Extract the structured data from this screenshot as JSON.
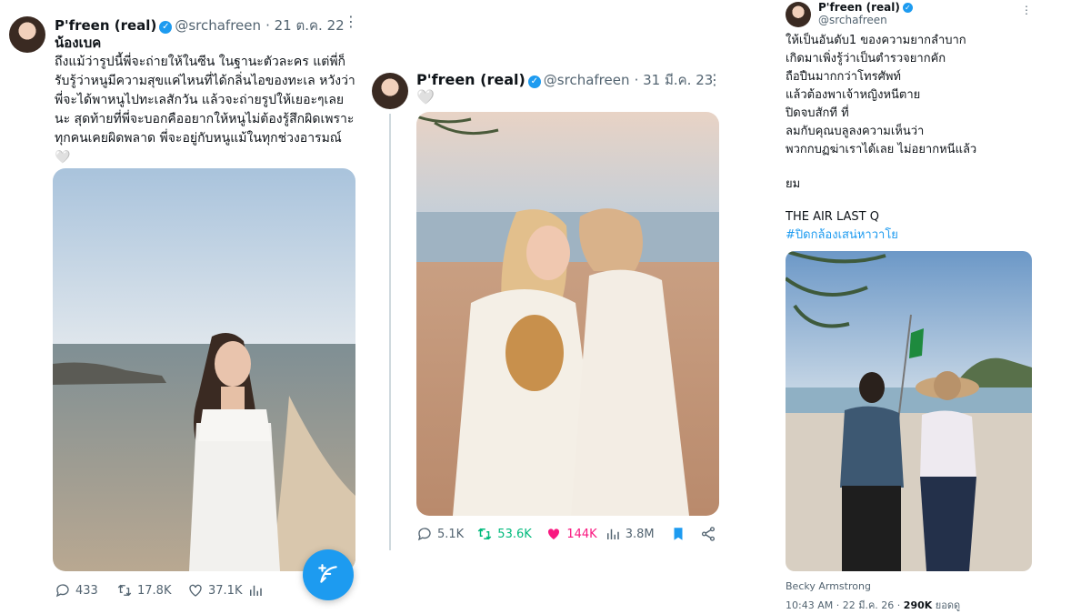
{
  "tweet1": {
    "name": "P'freen (real)",
    "handle": "@srchafreen",
    "date": "· 21 ต.ค. 22",
    "heading": "น้องเบค",
    "body": "ถึงแม้ว่ารูปนี้พี่จะถ่ายให้ในซีน ในฐานะตัวละคร แต่พี่ก็รับรู้ว่าหนูมีความสุขแค่ไหนที่ได้กลิ่นไอของทะเล หวังว่าพี่จะได้พาหนูไปทะเลสักวัน แล้วจะถ่ายรูปให้เยอะๆเลยนะ สุดท้ายที่พี่จะบอกคืออยากให้หนูไม่ต้องรู้สึกผิดเพราะทุกคนเคยผิดพลาด พี่จะอยู่กับหนูแม้ในทุกช่วงอารมณ์ 🤍",
    "replies": "433",
    "retweets": "17.8K",
    "likes": "37.1K",
    "views": ""
  },
  "tweet2": {
    "name": "P'freen (real)",
    "handle": "@srchafreen",
    "date": "· 31 มี.ค. 23",
    "body": "🤍",
    "replies": "5.1K",
    "retweets": "53.6K",
    "likes": "144K",
    "views": "3.8M"
  },
  "tweet3": {
    "name": "P'freen (real)",
    "handle": "@srchafreen",
    "lines": [
      "ให้เป็นอันดับ1 ของความยากลำบาก",
      "เกิดมาเพิ่งรู้ว่าเป็นตำรวจยากคัก",
      "ถือปืนมากกว่าโทรศัพท์",
      "แล้วต้องพาเจ้าหญิงหนีตาย",
      "ปิดจบสักที ที่",
      "ลมกับคุณบลูลงความเห็นว่า",
      "พวกกบฏฆ่าเราได้เลย ไม่อยากหนีแล้ว"
    ],
    "sign": "ยม",
    "show": "THE AIR LAST Q",
    "hashtag": "#ปิดกล้องเสน่หาวาโย",
    "photo_tag": "Becky Armstrong",
    "timestamp": "10:43 AM · 22 มี.ค. 26 ·",
    "views": "290K",
    "views_label": "ยอดดู"
  },
  "colors": {
    "accent": "#1d9bf0",
    "retweet_active": "#00ba7c",
    "like_active": "#f91880",
    "muted": "#536471"
  }
}
